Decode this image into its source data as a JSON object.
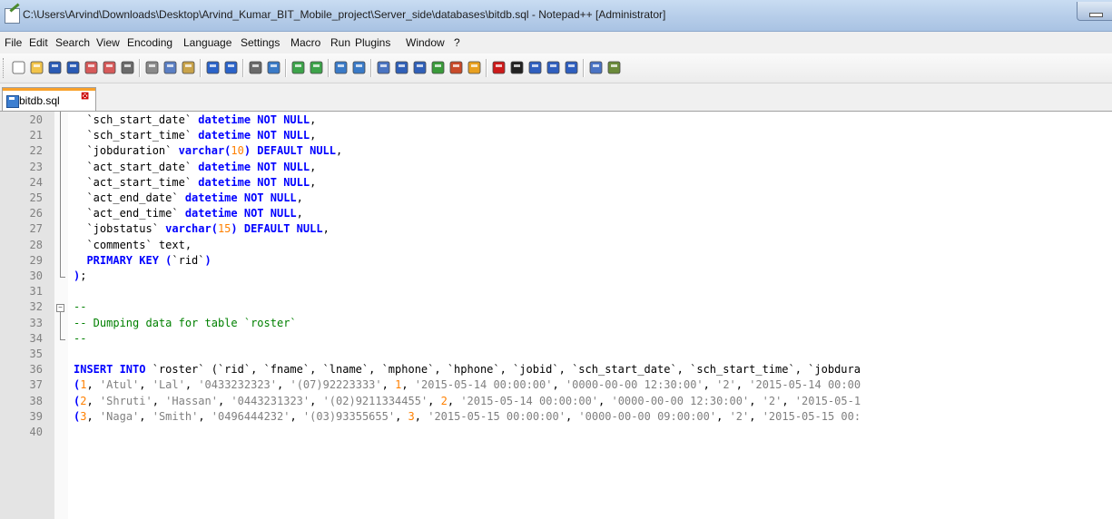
{
  "window": {
    "title": "C:\\Users\\Arvind\\Downloads\\Desktop\\Arvind_Kumar_BIT_Mobile_project\\Server_side\\databases\\bitdb.sql - Notepad++ [Administrator]"
  },
  "menu": [
    "File",
    "Edit",
    "Search",
    "View",
    "Encoding",
    "Language",
    "Settings",
    "Macro",
    "Run",
    "Plugins",
    "Window",
    "?"
  ],
  "toolbar": {
    "icons": [
      "new-file-icon",
      "open-file-icon",
      "save-icon",
      "save-all-icon",
      "close-icon",
      "close-all-icon",
      "print-icon",
      "cut-icon",
      "copy-icon",
      "paste-icon",
      "undo-icon",
      "redo-icon",
      "find-icon",
      "replace-icon",
      "zoom-in-icon",
      "zoom-out-icon",
      "sync-vertical-icon",
      "sync-horizontal-icon",
      "word-wrap-icon",
      "show-all-chars-icon",
      "indent-guide-icon",
      "document-map-icon",
      "function-list-icon",
      "folder-workspace-icon",
      "record-macro-icon",
      "stop-record-icon",
      "play-macro-icon",
      "run-macro-multiple-icon",
      "save-macro-icon",
      "spell-check-icon",
      "misc-icon"
    ]
  },
  "tab": {
    "label": "bitdb.sql",
    "close": "⊠"
  },
  "colors": {
    "keyword": "#0000ff",
    "number": "#ff8000",
    "string": "#808080",
    "comment": "#008000",
    "active_tab_accent": "#f9a12a"
  },
  "editor": {
    "lines": [
      {
        "n": "20",
        "tokens": [
          {
            "t": "  `sch_start_date` "
          },
          {
            "t": "datetime NOT NULL",
            "c": "kw"
          },
          {
            "t": ","
          }
        ]
      },
      {
        "n": "21",
        "tokens": [
          {
            "t": "  `sch_start_time` "
          },
          {
            "t": "datetime NOT NULL",
            "c": "kw"
          },
          {
            "t": ","
          }
        ]
      },
      {
        "n": "22",
        "tokens": [
          {
            "t": "  `jobduration` "
          },
          {
            "t": "varchar(",
            "c": "kw"
          },
          {
            "t": "10",
            "c": "num"
          },
          {
            "t": ") DEFAULT NULL",
            "c": "kw"
          },
          {
            "t": ","
          }
        ]
      },
      {
        "n": "23",
        "tokens": [
          {
            "t": "  `act_start_date` "
          },
          {
            "t": "datetime NOT NULL",
            "c": "kw"
          },
          {
            "t": ","
          }
        ]
      },
      {
        "n": "24",
        "tokens": [
          {
            "t": "  `act_start_time` "
          },
          {
            "t": "datetime NOT NULL",
            "c": "kw"
          },
          {
            "t": ","
          }
        ]
      },
      {
        "n": "25",
        "tokens": [
          {
            "t": "  `act_end_date` "
          },
          {
            "t": "datetime NOT NULL",
            "c": "kw"
          },
          {
            "t": ","
          }
        ]
      },
      {
        "n": "26",
        "tokens": [
          {
            "t": "  `act_end_time` "
          },
          {
            "t": "datetime NOT NULL",
            "c": "kw"
          },
          {
            "t": ","
          }
        ]
      },
      {
        "n": "27",
        "tokens": [
          {
            "t": "  `jobstatus` "
          },
          {
            "t": "varchar(",
            "c": "kw"
          },
          {
            "t": "15",
            "c": "num"
          },
          {
            "t": ") DEFAULT NULL",
            "c": "kw"
          },
          {
            "t": ","
          }
        ]
      },
      {
        "n": "28",
        "tokens": [
          {
            "t": "  `comments` text,"
          }
        ]
      },
      {
        "n": "29",
        "tokens": [
          {
            "t": "  "
          },
          {
            "t": "PRIMARY KEY (",
            "c": "kw"
          },
          {
            "t": "`rid`"
          },
          {
            "t": ")",
            "c": "kw"
          }
        ]
      },
      {
        "n": "30",
        "tokens": [
          {
            "t": ")",
            "c": "kw"
          },
          {
            "t": ";"
          }
        ]
      },
      {
        "n": "31",
        "tokens": []
      },
      {
        "n": "32",
        "tokens": [
          {
            "t": "--",
            "c": "cmt"
          }
        ]
      },
      {
        "n": "33",
        "tokens": [
          {
            "t": "-- Dumping data for table `roster`",
            "c": "cmt"
          }
        ]
      },
      {
        "n": "34",
        "tokens": [
          {
            "t": "--",
            "c": "cmt"
          }
        ]
      },
      {
        "n": "35",
        "tokens": []
      },
      {
        "n": "36",
        "tokens": [
          {
            "t": "INSERT INTO ",
            "c": "kw"
          },
          {
            "t": "`roster` ("
          },
          {
            "t": "`rid`, `fname`, `lname`, `mphone`, `hphone`, `jobid`, `sch_start_date`, `sch_start_time`, `jobdura"
          }
        ]
      },
      {
        "n": "37",
        "tokens": [
          {
            "t": "(",
            "c": "kw"
          },
          {
            "t": "1",
            "c": "num"
          },
          {
            "t": ", "
          },
          {
            "t": "'Atul'",
            "c": "str"
          },
          {
            "t": ", "
          },
          {
            "t": "'Lal'",
            "c": "str"
          },
          {
            "t": ", "
          },
          {
            "t": "'0433232323'",
            "c": "str"
          },
          {
            "t": ", "
          },
          {
            "t": "'(07)92223333'",
            "c": "str"
          },
          {
            "t": ", "
          },
          {
            "t": "1",
            "c": "num"
          },
          {
            "t": ", "
          },
          {
            "t": "'2015-05-14 00:00:00'",
            "c": "str"
          },
          {
            "t": ", "
          },
          {
            "t": "'0000-00-00 12:30:00'",
            "c": "str"
          },
          {
            "t": ", "
          },
          {
            "t": "'2'",
            "c": "str"
          },
          {
            "t": ", "
          },
          {
            "t": "'2015-05-14 00:00",
            "c": "str"
          }
        ]
      },
      {
        "n": "38",
        "tokens": [
          {
            "t": "(",
            "c": "kw"
          },
          {
            "t": "2",
            "c": "num"
          },
          {
            "t": ", "
          },
          {
            "t": "'Shruti'",
            "c": "str"
          },
          {
            "t": ", "
          },
          {
            "t": "'Hassan'",
            "c": "str"
          },
          {
            "t": ", "
          },
          {
            "t": "'0443231323'",
            "c": "str"
          },
          {
            "t": ", "
          },
          {
            "t": "'(02)9211334455'",
            "c": "str"
          },
          {
            "t": ", "
          },
          {
            "t": "2",
            "c": "num"
          },
          {
            "t": ", "
          },
          {
            "t": "'2015-05-14 00:00:00'",
            "c": "str"
          },
          {
            "t": ", "
          },
          {
            "t": "'0000-00-00 12:30:00'",
            "c": "str"
          },
          {
            "t": ", "
          },
          {
            "t": "'2'",
            "c": "str"
          },
          {
            "t": ", "
          },
          {
            "t": "'2015-05-1",
            "c": "str"
          }
        ]
      },
      {
        "n": "39",
        "tokens": [
          {
            "t": "(",
            "c": "kw"
          },
          {
            "t": "3",
            "c": "num"
          },
          {
            "t": ", "
          },
          {
            "t": "'Naga'",
            "c": "str"
          },
          {
            "t": ", "
          },
          {
            "t": "'Smith'",
            "c": "str"
          },
          {
            "t": ", "
          },
          {
            "t": "'0496444232'",
            "c": "str"
          },
          {
            "t": ", "
          },
          {
            "t": "'(03)93355655'",
            "c": "str"
          },
          {
            "t": ", "
          },
          {
            "t": "3",
            "c": "num"
          },
          {
            "t": ", "
          },
          {
            "t": "'2015-05-15 00:00:00'",
            "c": "str"
          },
          {
            "t": ", "
          },
          {
            "t": "'0000-00-00 09:00:00'",
            "c": "str"
          },
          {
            "t": ", "
          },
          {
            "t": "'2'",
            "c": "str"
          },
          {
            "t": ", "
          },
          {
            "t": "'2015-05-15 00:",
            "c": "str"
          }
        ]
      },
      {
        "n": "40",
        "tokens": []
      }
    ]
  }
}
